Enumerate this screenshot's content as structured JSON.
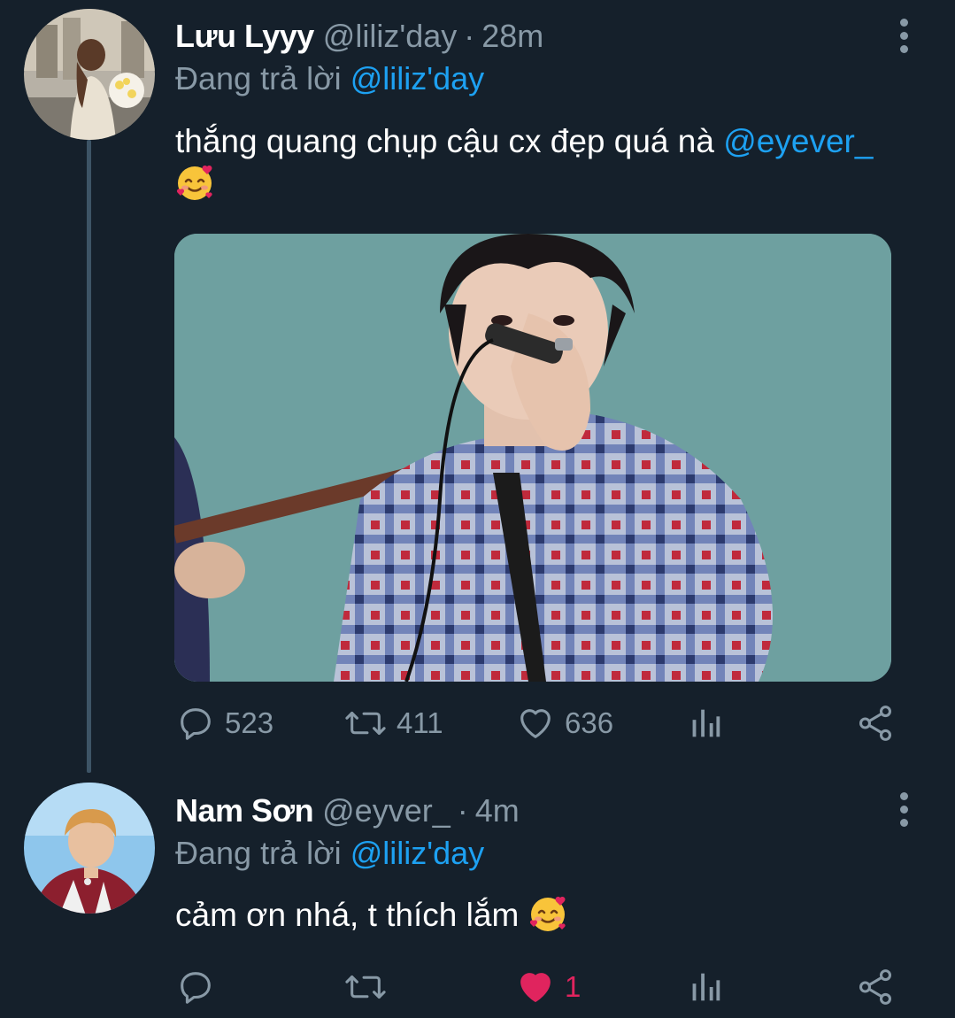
{
  "tweets": [
    {
      "display_name": "Lưu Lyyy",
      "handle": "@liliz'day",
      "separator": "·",
      "time": "28m",
      "reply_prefix": "Đang trả lời",
      "reply_mention": "@liliz'day",
      "text": "thắng quang chụp cậu cx đẹp quá nà",
      "text_mention": "@eyever_",
      "emoji": "smiling-face-with-hearts",
      "has_media": true,
      "actions": {
        "replies": "523",
        "retweets": "411",
        "likes": "636",
        "liked": false
      }
    },
    {
      "display_name": "Nam Sơn",
      "handle": "@eyver_",
      "separator": "·",
      "time": "4m",
      "reply_prefix": "Đang trả lời",
      "reply_mention": "@liliz'day",
      "text": "cảm ơn nhá, t thích lắm",
      "emoji": "smiling-face-with-hearts",
      "actions": {
        "replies": "",
        "retweets": "",
        "likes": "1",
        "liked": true
      }
    }
  ],
  "colors": {
    "background": "#15202b",
    "secondary_text": "#8899a6",
    "accent": "#1da1f2",
    "like": "#e0245e"
  }
}
